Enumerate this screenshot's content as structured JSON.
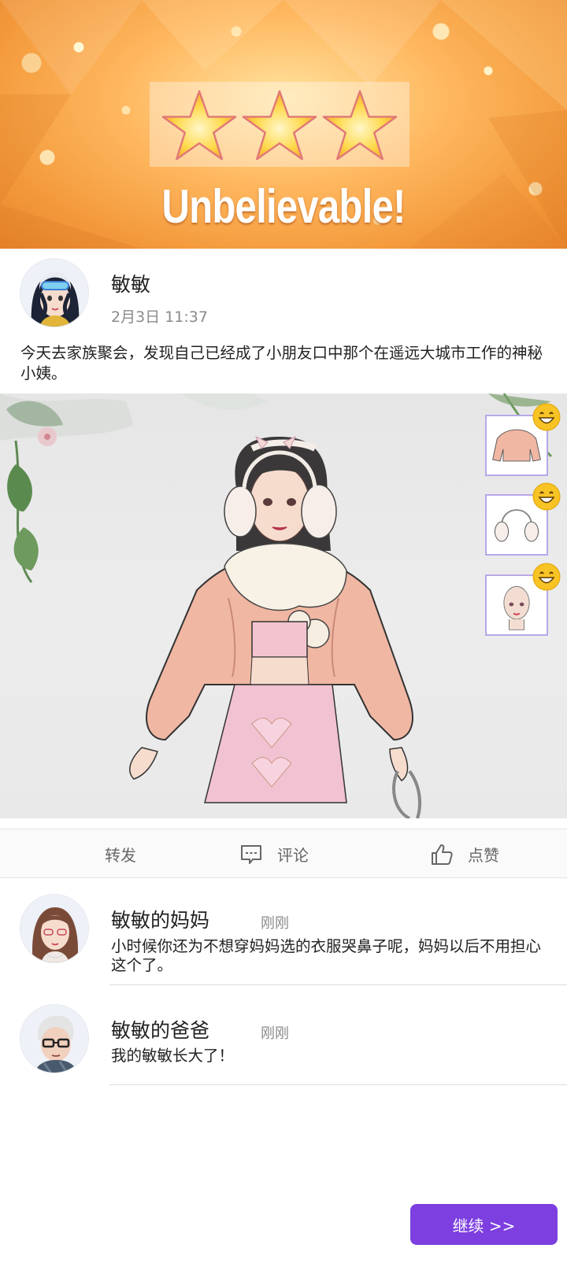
{
  "banner": {
    "title": "Unbelievable!",
    "stars": 3,
    "colors": {
      "bg": "#f39a3c",
      "star": "#ffd84a"
    }
  },
  "post": {
    "author": "敏敏",
    "time": "2月3日 11:37",
    "text": "今天去家族聚会，发现自己已经成了小朋友口中那个在遥远大城市工作的神秘小姨。"
  },
  "outfit": {
    "items": [
      {
        "icon": "puffer-jacket-icon",
        "badge": "grin-emoji-icon"
      },
      {
        "icon": "earmuffs-icon",
        "badge": "grin-emoji-icon"
      },
      {
        "icon": "face-icon",
        "badge": "grin-emoji-icon"
      }
    ]
  },
  "actions": {
    "share": "转发",
    "comment": "评论",
    "like": "点赞"
  },
  "comments": [
    {
      "author": "敏敏的妈妈",
      "time": "刚刚",
      "text": "小时候你还为不想穿妈妈选的衣服哭鼻子呢，妈妈以后不用担心这个了。"
    },
    {
      "author": "敏敏的爸爸",
      "time": "刚刚",
      "text": "我的敏敏长大了！"
    }
  ],
  "continue_label": "继续 >>",
  "accent_color": "#7d3fe0"
}
